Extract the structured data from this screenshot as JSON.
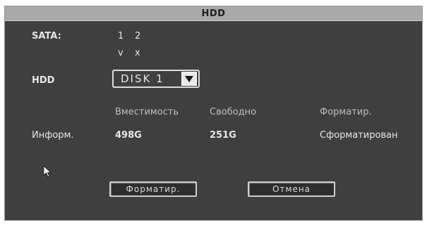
{
  "window": {
    "title": "HDD"
  },
  "sata": {
    "label": "SATA:",
    "ports": [
      "1",
      "2"
    ],
    "status": [
      "v",
      "x"
    ]
  },
  "hdd": {
    "label": "HDD",
    "selected_disk": "DISK 1"
  },
  "info": {
    "row_label": "Информ.",
    "headers": {
      "capacity": "Вместимость",
      "free": "Свободно",
      "format": "Форматир."
    },
    "values": {
      "capacity": "498G",
      "free": "251G",
      "format": "Сформатирован"
    }
  },
  "buttons": {
    "format": "Форматир.",
    "cancel": "Отмена"
  },
  "icons": {
    "dropdown": "triangle-down-icon",
    "cursor": "mouse-pointer-icon"
  }
}
